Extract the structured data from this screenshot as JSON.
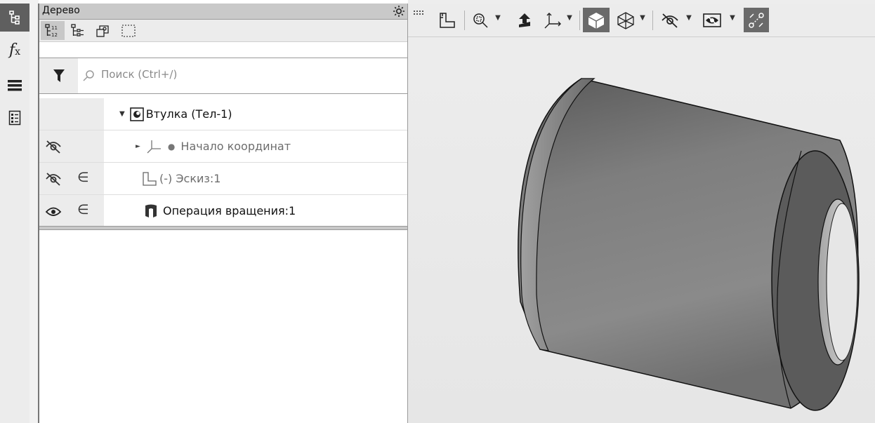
{
  "panel": {
    "title": "Дерево",
    "search_placeholder": "Поиск (Ctrl+/)"
  },
  "strip": {
    "tabs": [
      "tree-icon",
      "formula-icon",
      "layers-icon",
      "properties-icon"
    ]
  },
  "tree": {
    "root": "Втулка (Тел-1)",
    "items": [
      {
        "label": "Начало координат",
        "visibility": "hidden"
      },
      {
        "label": "(-) Эскиз:1",
        "visibility": "hidden"
      },
      {
        "label": "Операция вращения:1",
        "visibility": "visible"
      }
    ]
  },
  "colors": {
    "panel_header": "#c9c9c9",
    "toolbar": "#ececec",
    "selected_tool": "#6a6a6a",
    "part_body": "#7c7c7c"
  }
}
